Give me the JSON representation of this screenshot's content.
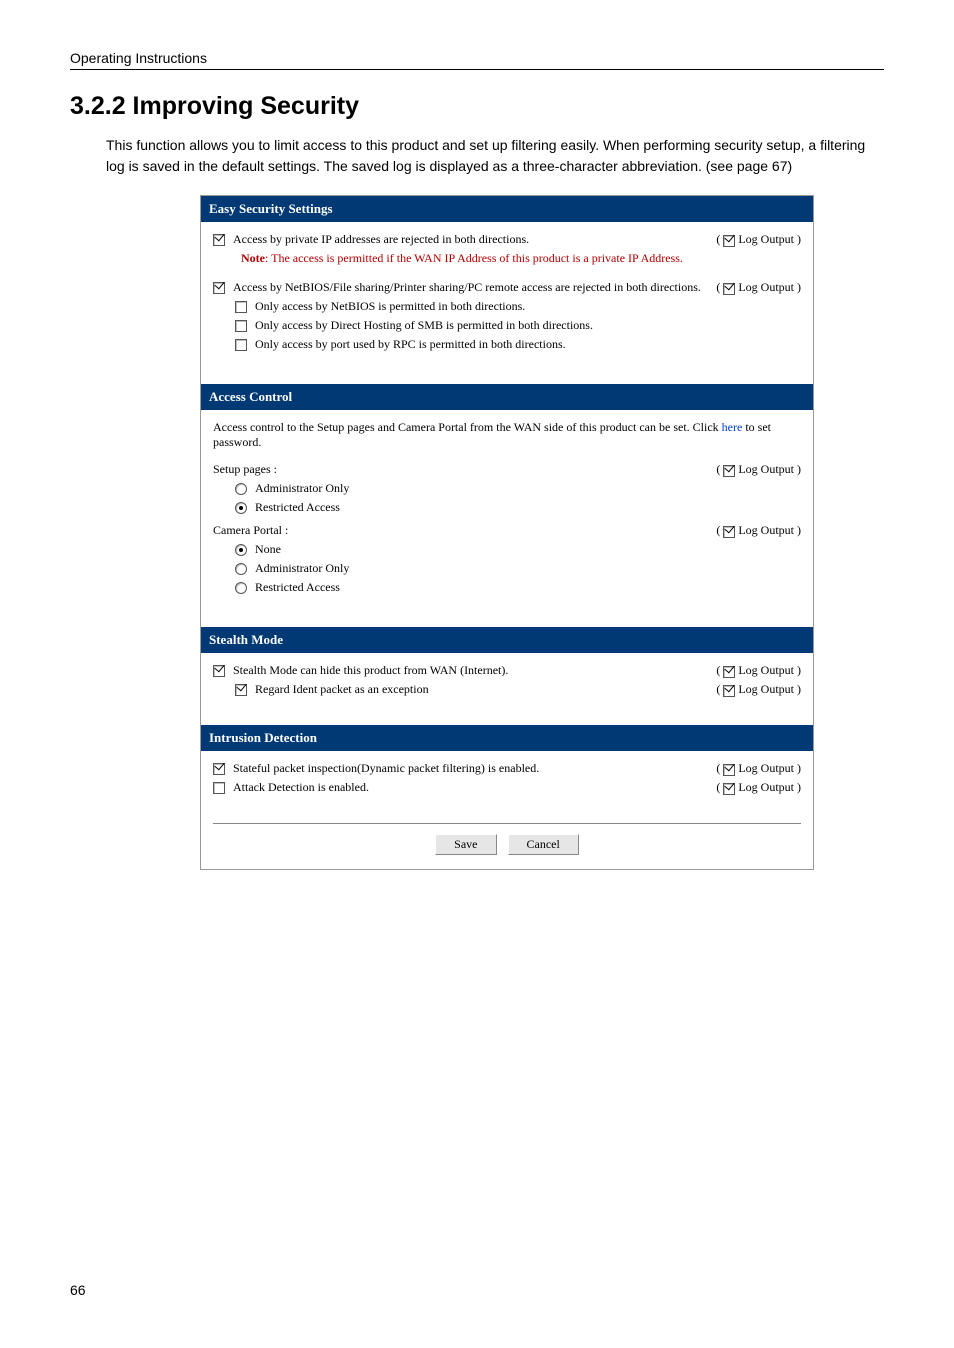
{
  "running_head": "Operating Instructions",
  "heading": "3.2.2    Improving Security",
  "intro": "This function allows you to limit access to this product and set up filtering easily. When performing security setup, a filtering log is saved in the default settings. The saved log is displayed as a three-character abbreviation. (see page 67)",
  "log_label": "Log Output",
  "sections": {
    "easy": {
      "title": "Easy Security Settings",
      "item1": "Access by private IP addresses are rejected in both directions.",
      "note_prefix": "Note",
      "note_rest": ": The access is permitted if the WAN IP Address of this product is a private IP Address.",
      "item2": "Access by NetBIOS/File sharing/Printer sharing/PC remote access are rejected in both directions.",
      "sub_a": "Only access by NetBIOS is permitted in both directions.",
      "sub_b": "Only access by Direct Hosting of SMB is permitted in both directions.",
      "sub_c": "Only access by port used by RPC is permitted in both directions."
    },
    "access": {
      "title": "Access Control",
      "desc_a": "Access control to the Setup pages and Camera Portal from the WAN side of this product can be set. Click ",
      "here": "here",
      "desc_b": " to set password.",
      "setup_label": "Setup pages :",
      "opt_admin": "Administrator Only",
      "opt_restricted": "Restricted Access",
      "camera_label": "Camera Portal :",
      "opt_none": "None"
    },
    "stealth": {
      "title": "Stealth Mode",
      "item1": "Stealth Mode can hide this product from WAN (Internet).",
      "item2": "Regard Ident packet as an exception"
    },
    "intrusion": {
      "title": "Intrusion Detection",
      "item1": "Stateful packet inspection(Dynamic packet filtering) is enabled.",
      "item2": "Attack Detection is enabled."
    }
  },
  "buttons": {
    "save": "Save",
    "cancel": "Cancel"
  },
  "page_number": "66"
}
